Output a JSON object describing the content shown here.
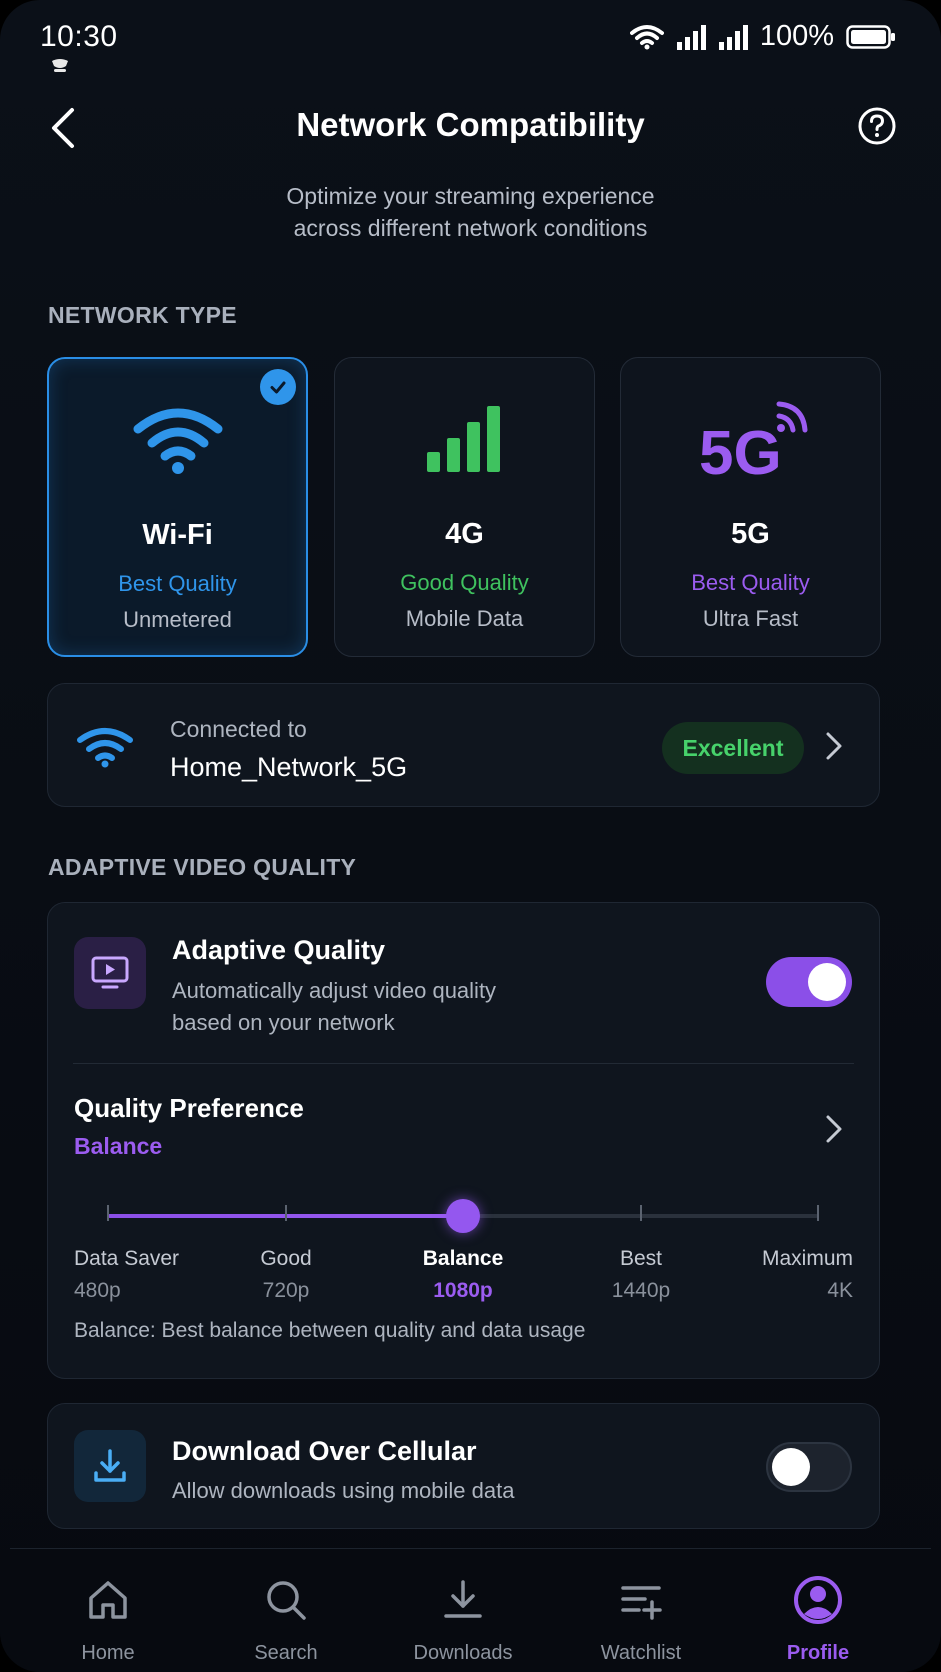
{
  "status_bar": {
    "time": "10:30",
    "battery": "100%"
  },
  "header": {
    "title": "Network Compatibility",
    "subtitle_line1": "Optimize your streaming experience",
    "subtitle_line2": "across different network conditions"
  },
  "network_type": {
    "heading": "NETWORK TYPE",
    "cards": [
      {
        "name": "Wi-Fi",
        "quality": "Best Quality",
        "sub": "Unmetered",
        "color": "#2f95ea",
        "selected": true,
        "icon": "wifi-icon"
      },
      {
        "name": "4G",
        "quality": "Good Quality",
        "sub": "Mobile Data",
        "color": "#3fc25f",
        "selected": false,
        "icon": "signal-bars-icon"
      },
      {
        "name": "5G",
        "quality": "Best Quality",
        "sub": "Ultra Fast",
        "color": "#9b5cf0",
        "selected": false,
        "icon": "5g-icon",
        "icon_text": "5G"
      }
    ]
  },
  "connection": {
    "label": "Connected to",
    "network": "Home_Network_5G",
    "status": "Excellent"
  },
  "adaptive": {
    "heading": "ADAPTIVE VIDEO QUALITY",
    "title": "Adaptive Quality",
    "desc_line1": "Automatically adjust video quality",
    "desc_line2": "based on your network",
    "enabled": true,
    "pref_title": "Quality Preference",
    "pref_value": "Balance",
    "slider_value_index": 2,
    "stops": [
      {
        "label": "Data Saver",
        "res": "480p"
      },
      {
        "label": "Good",
        "res": "720p"
      },
      {
        "label": "Balance",
        "res": "1080p"
      },
      {
        "label": "Best",
        "res": "1440p"
      },
      {
        "label": "Maximum",
        "res": "4K"
      }
    ],
    "note": "Balance: Best balance between quality and data usage"
  },
  "download": {
    "title": "Download Over Cellular",
    "desc": "Allow downloads using mobile data",
    "enabled": false
  },
  "nav": [
    {
      "label": "Home",
      "icon": "home-icon"
    },
    {
      "label": "Search",
      "icon": "search-icon"
    },
    {
      "label": "Downloads",
      "icon": "download-icon"
    },
    {
      "label": "Watchlist",
      "icon": "watchlist-icon"
    },
    {
      "label": "Profile",
      "icon": "profile-icon",
      "active": true
    }
  ],
  "colors": {
    "accent": "#9b5cf0",
    "wifi": "#2f95ea",
    "good": "#3fc25f",
    "excellent": "#47d26b"
  }
}
